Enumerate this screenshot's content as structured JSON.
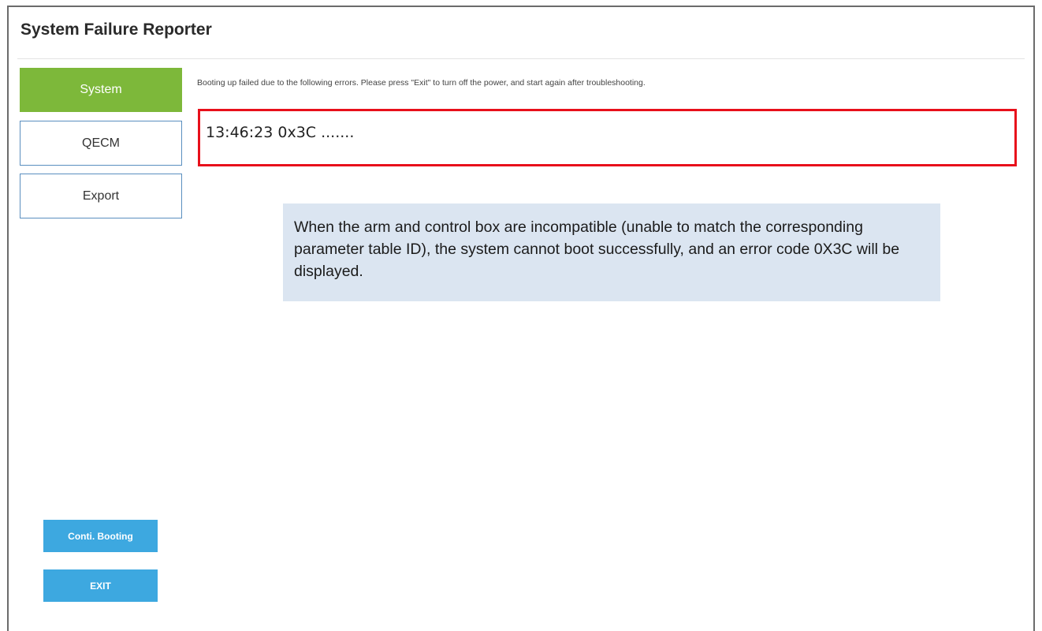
{
  "app": {
    "title": "System Failure Reporter"
  },
  "sidebar": {
    "items": [
      {
        "label": "System",
        "active": true
      },
      {
        "label": "QECM",
        "active": false
      },
      {
        "label": "Export",
        "active": false
      }
    ]
  },
  "main": {
    "message": "Booting up failed due to the following errors. Please press \"Exit\" to turn off the power, and start again after troubleshooting.",
    "error_entry": "13:46:23 0x3C .......",
    "note": "When the arm and control box are incompatible (unable to match the corresponding parameter table ID), the system cannot boot successfully, and an error code 0X3C will be displayed."
  },
  "actions": {
    "conti_label": "Conti. Booting",
    "exit_label": "EXIT"
  },
  "colors": {
    "active_tab": "#7db83a",
    "error_border": "#e8101b",
    "action_button": "#3da8e0",
    "note_background": "#dbe5f1"
  }
}
